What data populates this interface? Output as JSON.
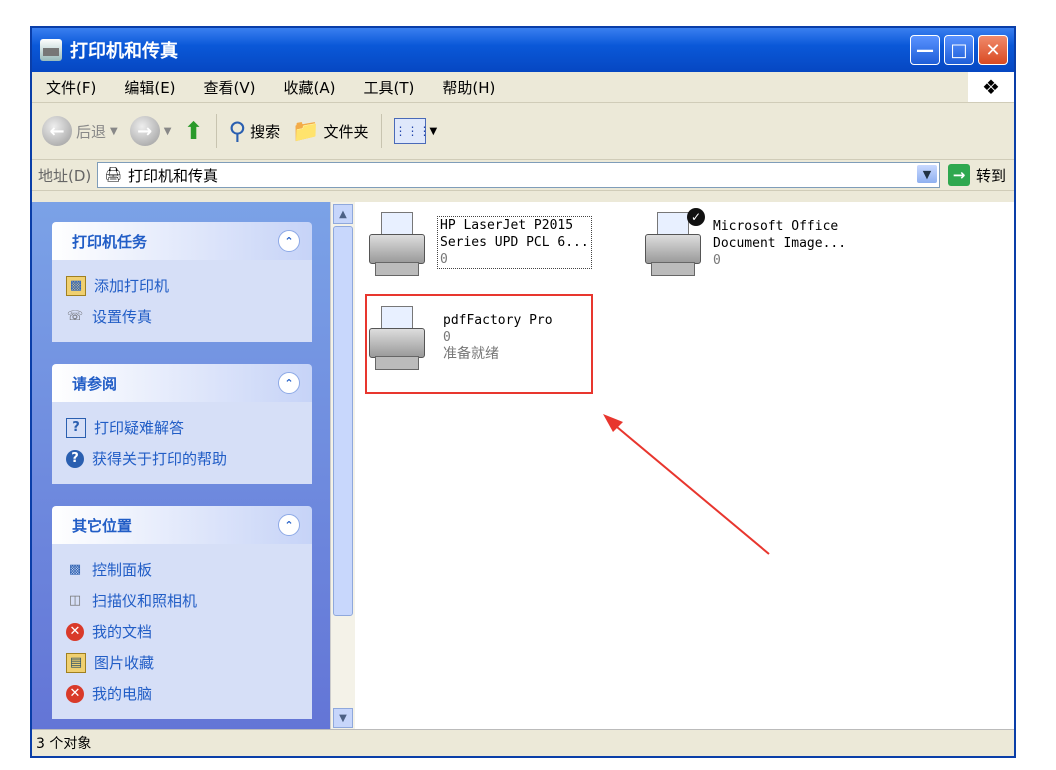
{
  "window": {
    "title": "打印机和传真"
  },
  "menu": [
    "文件(F)",
    "编辑(E)",
    "查看(V)",
    "收藏(A)",
    "工具(T)",
    "帮助(H)"
  ],
  "toolbar": {
    "back": "后退",
    "search": "搜索",
    "folders": "文件夹"
  },
  "address": {
    "label": "地址(D)",
    "value": "打印机和传真",
    "go": "转到"
  },
  "panels": [
    {
      "title": "打印机任务",
      "items": [
        "添加打印机",
        "设置传真"
      ]
    },
    {
      "title": "请参阅",
      "items": [
        "打印疑难解答",
        "获得关于打印的帮助"
      ]
    },
    {
      "title": "其它位置",
      "items": [
        "控制面板",
        "扫描仪和照相机",
        "我的文档",
        "图片收藏",
        "我的电脑"
      ]
    }
  ],
  "printers": [
    {
      "name1": "HP LaserJet P2015",
      "name2": "Series UPD PCL 6...",
      "count": "0",
      "status": ""
    },
    {
      "name1": "Microsoft Office",
      "name2": "Document Image...",
      "count": "0",
      "status": ""
    },
    {
      "name1": "pdfFactory Pro",
      "name2": "",
      "count": "0",
      "status": "准备就绪"
    }
  ],
  "statusbar": {
    "text": "3 个对象"
  },
  "colors": {
    "titlebar": "#0a58d8",
    "taskpane": "#6375d6",
    "highlight": "#e8362e"
  }
}
